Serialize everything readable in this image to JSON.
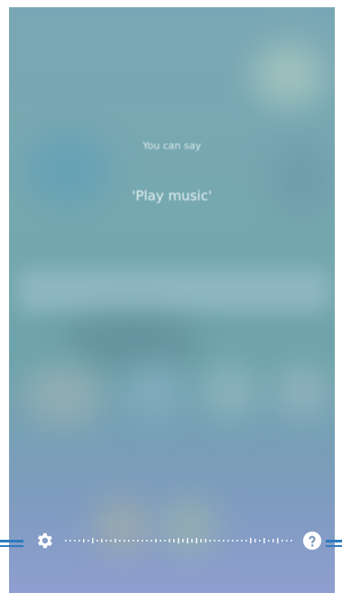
{
  "voice_prompt": {
    "hint_small": "You can say",
    "hint_example": "'Play music'"
  },
  "controls": {
    "settings_icon": "gear-icon",
    "help_icon": "question-icon",
    "accent_color": "#2d7bbf"
  }
}
